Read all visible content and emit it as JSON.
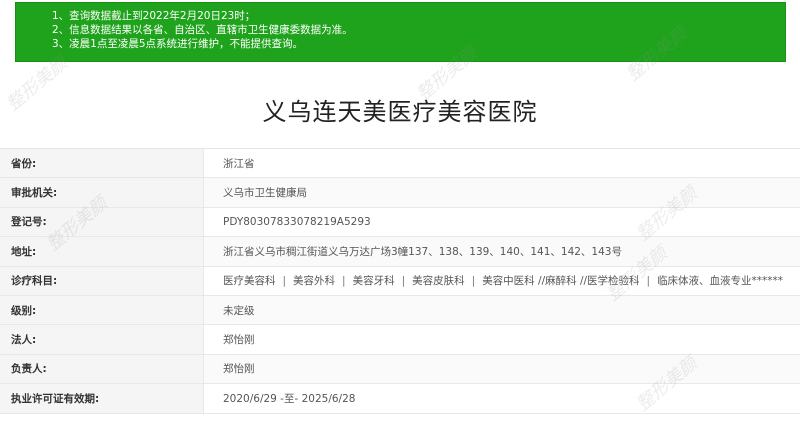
{
  "notice": {
    "lines": [
      "1、查询数据截止到2022年2月20日23时；",
      "2、信息数据结果以各省、自治区、直辖市卫生健康委数据为准。",
      "3、凌晨1点至凌晨5点系统进行维护，不能提供查询。"
    ]
  },
  "title": "义乌连天美医疗美容医院",
  "rows": [
    {
      "label": "省份:",
      "value": "浙江省"
    },
    {
      "label": "审批机关:",
      "value": "义乌市卫生健康局"
    },
    {
      "label": "登记号:",
      "value": "PDY80307833078219A5293"
    },
    {
      "label": "地址:",
      "value": "浙江省义乌市稠江街道义乌万达广场3幢137、138、139、140、141、142、143号"
    },
    {
      "label": "诊疗科目:",
      "departments": [
        "医疗美容科",
        "美容外科",
        "美容牙科",
        "美容皮肤科",
        "美容中医科 //麻醉科 //医学检验科",
        "临床体液、血液专业******"
      ],
      "separator": "|"
    },
    {
      "label": "级别:",
      "value": "未定级"
    },
    {
      "label": "法人:",
      "value": "郑怡刚"
    },
    {
      "label": "负责人:",
      "value": "郑怡刚"
    },
    {
      "label": "执业许可证有效期:",
      "value": "2020/6/29 -至- 2025/6/28"
    }
  ],
  "watermark": "整形美颜"
}
